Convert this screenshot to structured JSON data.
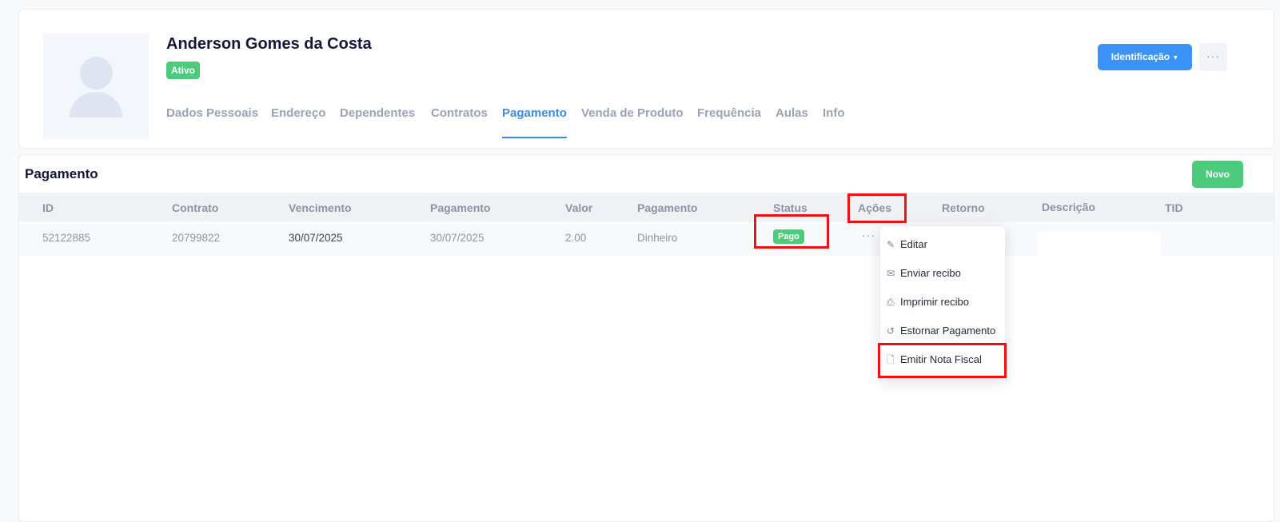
{
  "profile": {
    "name": "Anderson Gomes da Costa",
    "status": "Ativo",
    "identify_button": "Identificação",
    "more_button": "···"
  },
  "tabs": [
    {
      "label": "Dados Pessoais"
    },
    {
      "label": "Endereço"
    },
    {
      "label": "Dependentes"
    },
    {
      "label": "Contratos"
    },
    {
      "label": "Pagamento"
    },
    {
      "label": "Venda de Produto"
    },
    {
      "label": "Frequência"
    },
    {
      "label": "Aulas"
    },
    {
      "label": "Info"
    }
  ],
  "active_tab": "Pagamento",
  "payments": {
    "title": "Pagamento",
    "new_button": "Novo",
    "columns": [
      "ID",
      "Contrato",
      "Vencimento",
      "Pagamento",
      "Valor",
      "Pagamento",
      "Status",
      "Ações",
      "Retorno",
      "Descrição",
      "TID"
    ],
    "rows": [
      {
        "id": "52122885",
        "contrato": "20799822",
        "vencimento": "30/07/2025",
        "pagamento": "30/07/2025",
        "valor": "2.00",
        "forma": "Dinheiro",
        "status": "Pago",
        "actions": "···"
      }
    ]
  },
  "actions_menu": [
    {
      "label": "Editar",
      "icon": "edit-icon"
    },
    {
      "label": "Enviar recibo",
      "icon": "mail-icon"
    },
    {
      "label": "Imprimir recibo",
      "icon": "printer-icon"
    },
    {
      "label": "Estornar Pagamento",
      "icon": "undo-icon"
    },
    {
      "label": "Emitir Nota Fiscal",
      "icon": "file-icon"
    }
  ],
  "colors": {
    "primary": "#3b93f7",
    "success": "#4ccb7c",
    "highlight": "#ee1111"
  }
}
